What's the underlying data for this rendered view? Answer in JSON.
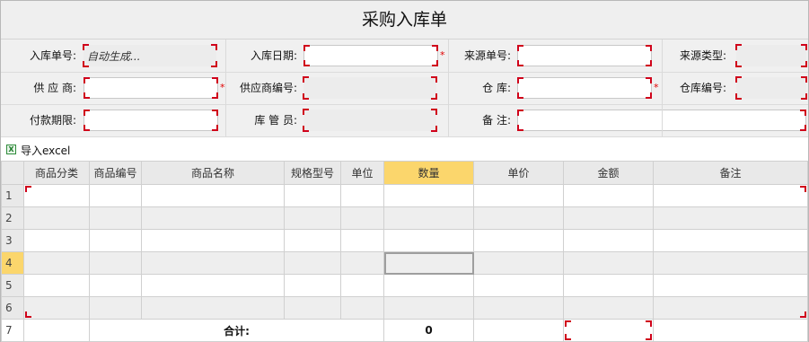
{
  "title": "采购入库单",
  "form": {
    "row1": {
      "order_no_label": "入库单号:",
      "order_no_value": "自动生成...",
      "date_label": "入库日期:",
      "date_value": "",
      "source_no_label": "来源单号:",
      "source_no_value": "",
      "source_type_label": "来源类型:",
      "source_type_value": ""
    },
    "row2": {
      "supplier_label": "供 应 商:",
      "supplier_value": "",
      "supplier_code_label": "供应商编号:",
      "supplier_code_value": "",
      "warehouse_label": "仓 库:",
      "warehouse_value": "",
      "warehouse_code_label": "仓库编号:",
      "warehouse_code_value": ""
    },
    "row3": {
      "payment_term_label": "付款期限:",
      "payment_term_value": "",
      "keeper_label": "库 管 员:",
      "keeper_value": "",
      "remark_label": "备 注:",
      "remark_value": ""
    },
    "required_mark": "*"
  },
  "toolbar": {
    "import_icon": "excel-icon",
    "import_icon_glyph": "X",
    "import_label": "导入excel"
  },
  "grid": {
    "columns": [
      "商品分类",
      "商品编号",
      "商品名称",
      "规格型号",
      "单位",
      "数量",
      "单价",
      "金额",
      "备注"
    ],
    "active_column": "数量",
    "row_numbers": [
      "1",
      "2",
      "3",
      "4",
      "5",
      "6",
      "7"
    ],
    "active_row": "4",
    "total_label": "合计:",
    "total_quantity": "0"
  },
  "colors": {
    "required": "#e00000",
    "active_header": "#fbd66c",
    "corner_marker": "#d0021b"
  }
}
